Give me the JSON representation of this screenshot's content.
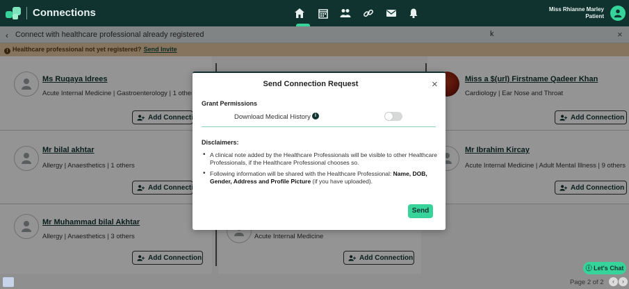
{
  "app": {
    "title": "Connections",
    "user_name": "Miss Rhianne Marley",
    "user_role": "Patient"
  },
  "nav": {
    "icons": [
      "home-icon",
      "calendar-icon",
      "people-icon",
      "link-icon",
      "mail-icon",
      "bell-icon"
    ],
    "active": "people-icon"
  },
  "subheader": {
    "title": "Connect with healthcare professional already registered",
    "search_value": "k"
  },
  "banner": {
    "text": "Healthcare professional not yet registered?",
    "link": "Send Invite"
  },
  "cards": [
    {
      "name": "Ms Ruqaya Idrees",
      "specialty": "Acute Internal Medicine | Gastroenterology | 1 others",
      "button": "Add Connection"
    },
    {
      "name": "Miss a $(url) Firstname Qadeer Khan",
      "specialty": "Cardiology | Ear Nose and Throat",
      "button": "Add Connection"
    },
    {
      "name": "Mr bilal akhtar",
      "specialty": "Allergy | Anaesthetics | 1 others",
      "button": "Add Connection"
    },
    {
      "name": "Mr Ibrahim Kircay",
      "specialty": "Acute Internal Medicine | Adult Mental Illness | 9 others",
      "button": "Add Connection"
    },
    {
      "name": "Mr Muhammad bilal Akhtar",
      "specialty": "Allergy | Anaesthetics | 3 others",
      "button": "Add Connection"
    },
    {
      "name": "",
      "specialty": "Acute Internal Medicine",
      "button": "Add Connection"
    }
  ],
  "modal": {
    "title": "Send Connection Request",
    "grant_title": "Grant Permissions",
    "permission_label": "Download Medical History",
    "permission_enabled": false,
    "disclaimers_title": "Disclaimers:",
    "disclaimer_1": "A clinical note added by the Healthcare Professionals will be visible to other Healthcare Professionals, if the Healthcare Professional chooses so.",
    "disclaimer_2_prefix": "Following information will be shared with the Healthcare Professional: ",
    "disclaimer_2_bold": "Name, DOB, Gender, Address and Profile Picture",
    "disclaimer_2_suffix": " (if you have uploaded).",
    "send_label": "Send"
  },
  "footer": {
    "chat_label": "Let's Chat",
    "page_info": "Page 2 of 2",
    "prev": "‹",
    "next": "›"
  },
  "colors": {
    "topbar": "#10332f",
    "accent": "#36d39b",
    "banner": "#e9c9a2"
  }
}
